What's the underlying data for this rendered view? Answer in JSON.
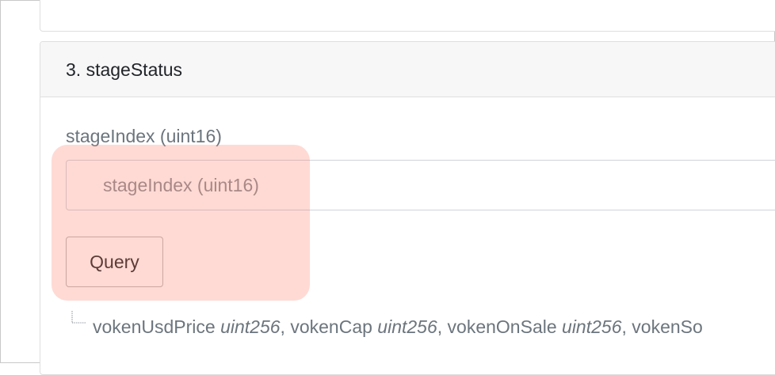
{
  "card": {
    "title": "3. stageStatus"
  },
  "field": {
    "label": "stageIndex (uint16)",
    "placeholder": "stageIndex (uint16)",
    "value": ""
  },
  "query_button": {
    "label": "Query"
  },
  "outputs": [
    {
      "name": "vokenUsdPrice",
      "type": "uint256",
      "sep": ", "
    },
    {
      "name": "vokenCap",
      "type": "uint256",
      "sep": ", "
    },
    {
      "name": "vokenOnSale",
      "type": "uint256",
      "sep": ", "
    },
    {
      "name": "vokenSo",
      "type": "",
      "sep": ""
    }
  ],
  "colors": {
    "highlight": "#ffd9d1",
    "header_bg": "#f7f7f7",
    "muted_text": "#6c757d"
  }
}
